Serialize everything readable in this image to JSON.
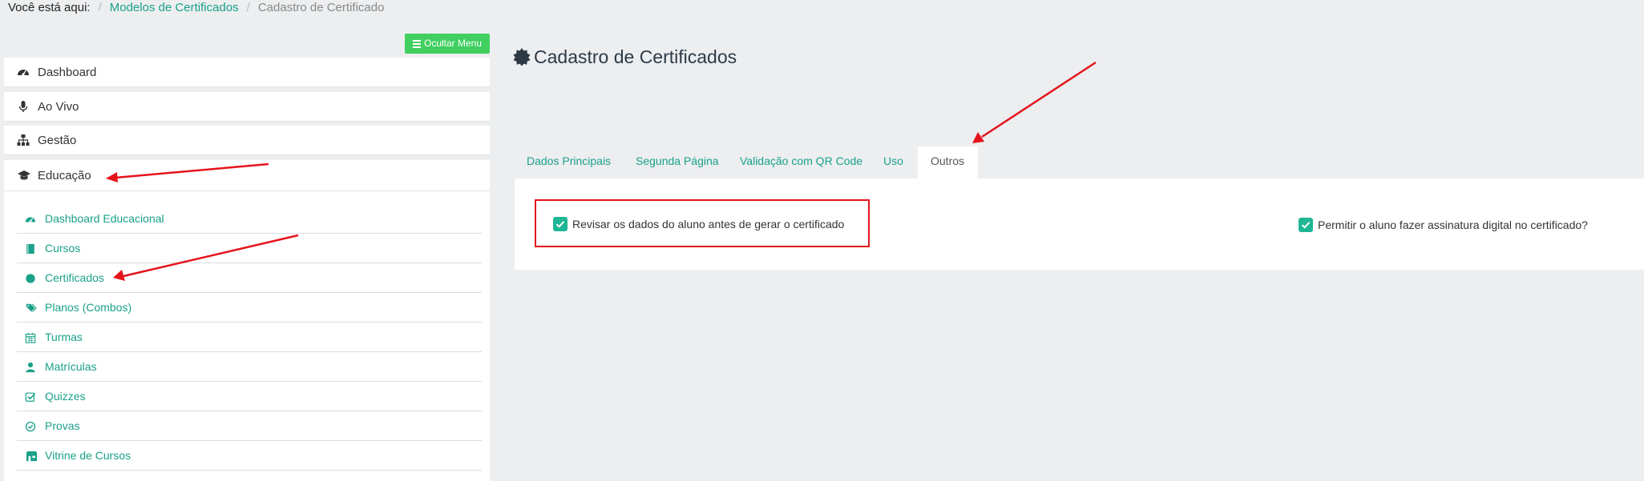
{
  "breadcrumb": {
    "label": "Você está aqui:",
    "links": [
      "Modelos de Certificados"
    ],
    "current": "Cadastro de Certificado"
  },
  "sidebar": {
    "hide_menu_label": "Ocultar Menu",
    "items": [
      {
        "label": "Dashboard",
        "icon": "dashboard-icon"
      },
      {
        "label": "Ao Vivo",
        "icon": "microphone-icon"
      },
      {
        "label": "Gestão",
        "icon": "sitemap-icon"
      },
      {
        "label": "Educação",
        "icon": "graduation-cap-icon"
      }
    ],
    "education_submenu": [
      {
        "label": "Dashboard Educacional",
        "icon": "dashboard-icon"
      },
      {
        "label": "Cursos",
        "icon": "book-icon"
      },
      {
        "label": "Certificados",
        "icon": "certificate-icon"
      },
      {
        "label": "Planos (Combos)",
        "icon": "tags-icon"
      },
      {
        "label": "Turmas",
        "icon": "calendar-icon"
      },
      {
        "label": "Matrículas",
        "icon": "user-icon"
      },
      {
        "label": "Quizzes",
        "icon": "check-square-icon"
      },
      {
        "label": "Provas",
        "icon": "check-circle-icon"
      },
      {
        "label": "Vitrine de Cursos",
        "icon": "storefront-icon"
      }
    ]
  },
  "main": {
    "title": "Cadastro de Certificados",
    "tabs": [
      {
        "label": "Dados Principais",
        "active": false
      },
      {
        "label": "Segunda Página",
        "active": false
      },
      {
        "label": "Validação com QR Code",
        "active": false
      },
      {
        "label": "Uso",
        "active": false
      },
      {
        "label": "Outros",
        "active": true
      }
    ],
    "options": [
      {
        "label": "Revisar os dados do aluno antes de gerar o certificado",
        "checked": true
      },
      {
        "label": "Permitir o aluno fazer assinatura digital no certificado?",
        "checked": true
      }
    ]
  },
  "colors": {
    "accent": "#1aa189",
    "button_green": "#41cf5f",
    "checkbox": "#1fb695",
    "annotation_red": "#e5141b",
    "background": "#eceef0"
  }
}
